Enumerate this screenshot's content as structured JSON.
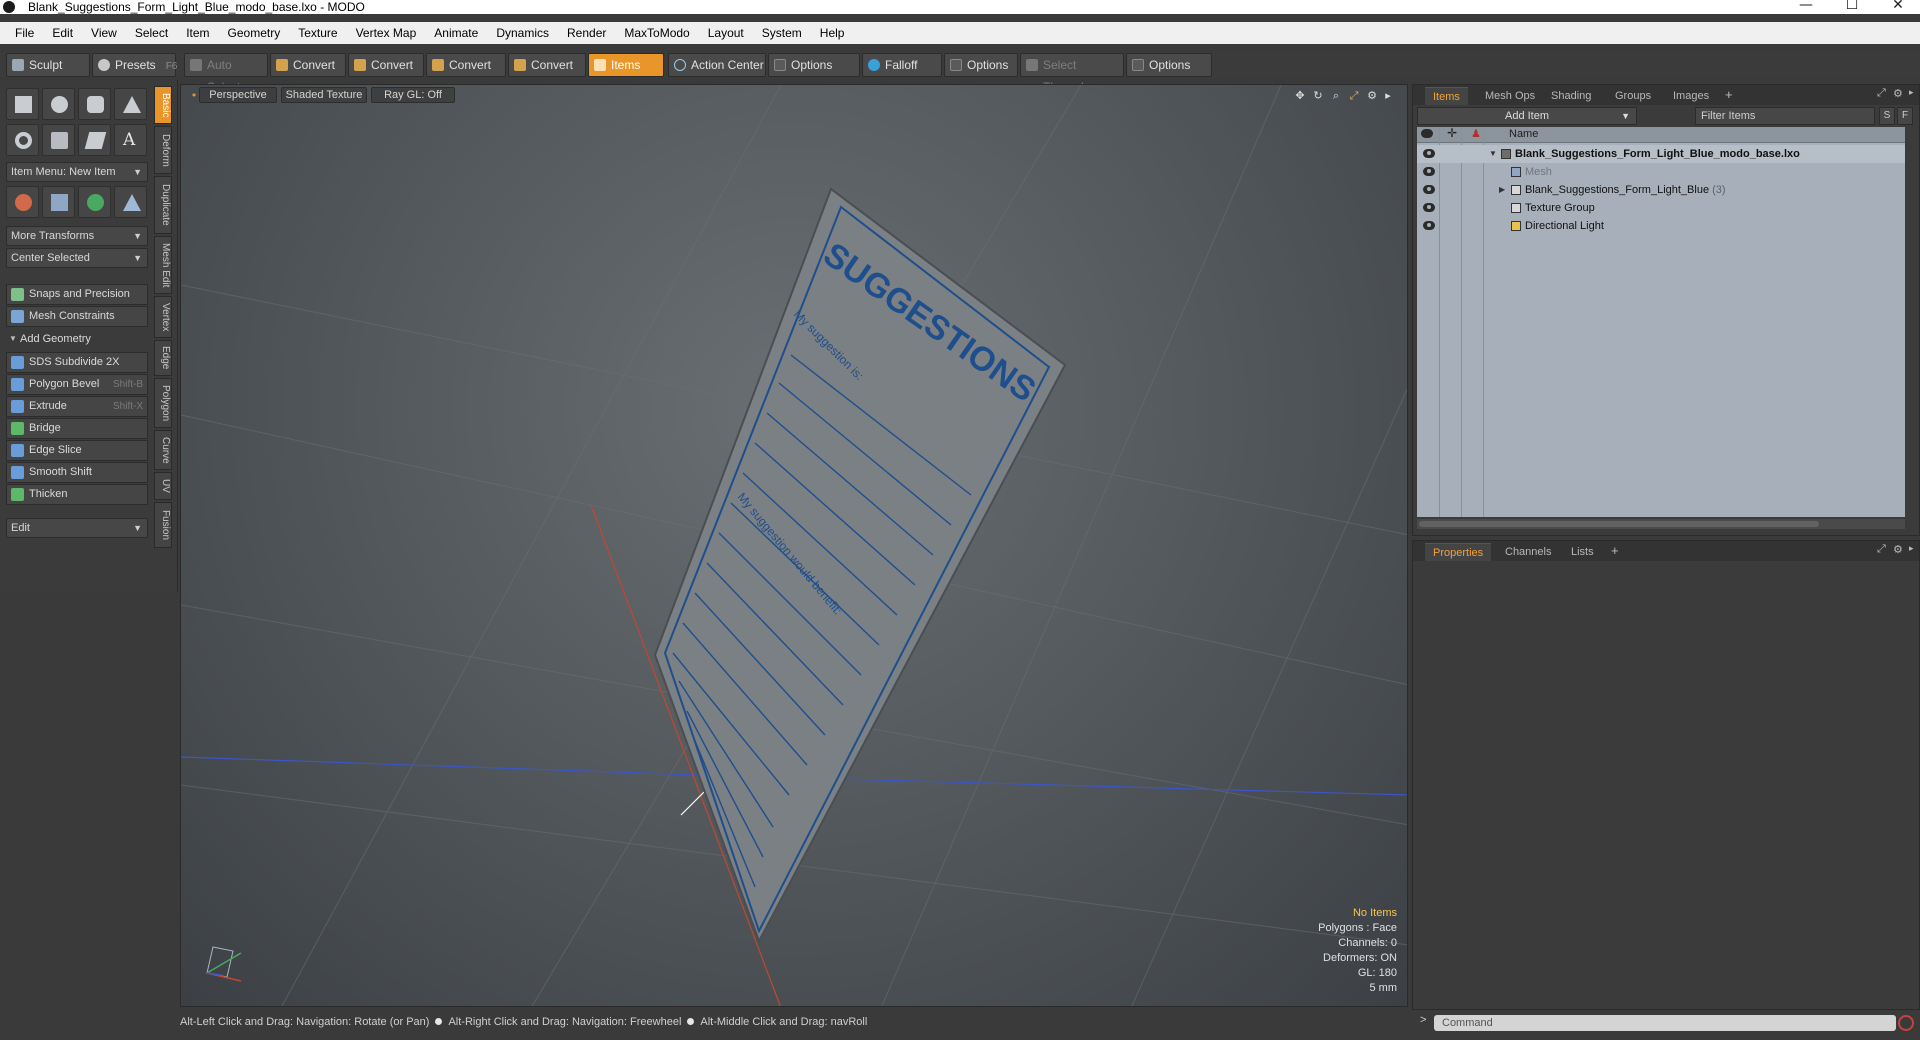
{
  "window": {
    "title": "Blank_Suggestions_Form_Light_Blue_modo_base.lxo - MODO",
    "minimize": "—",
    "maximize": "☐",
    "close": "✕"
  },
  "menu": [
    "File",
    "Edit",
    "View",
    "Select",
    "Item",
    "Geometry",
    "Texture",
    "Vertex Map",
    "Animate",
    "Dynamics",
    "Render",
    "MaxToModo",
    "Layout",
    "System",
    "Help"
  ],
  "toolbar": {
    "sculpt": "Sculpt",
    "presets": "Presets",
    "presets_key": "F6",
    "auto_select": "Auto Select",
    "convert1": "Convert",
    "convert2": "Convert",
    "convert3": "Convert",
    "convert4": "Convert",
    "items": "Items",
    "action_center": "Action Center",
    "options1": "Options",
    "falloff": "Falloff",
    "options2": "Options",
    "select_through": "Select Through",
    "options3": "Options"
  },
  "leftpanel": {
    "item_menu": "Item Menu: New Item",
    "more_transforms": "More Transforms",
    "center_selected": "Center Selected",
    "snaps": "Snaps and Precision",
    "mesh_constraints": "Mesh Constraints",
    "add_geometry": "Add Geometry",
    "tools": [
      {
        "label": "SDS Subdivide 2X",
        "shortcut": ""
      },
      {
        "label": "Polygon Bevel",
        "shortcut": "Shift-B"
      },
      {
        "label": "Extrude",
        "shortcut": "Shift-X"
      },
      {
        "label": "Bridge",
        "shortcut": ""
      },
      {
        "label": "Edge Slice",
        "shortcut": ""
      },
      {
        "label": "Smooth Shift",
        "shortcut": ""
      },
      {
        "label": "Thicken",
        "shortcut": ""
      }
    ],
    "edit": "Edit",
    "vtabs": [
      "Basic",
      "Deform",
      "Duplicate",
      "Mesh Edit",
      "Vertex",
      "Edge",
      "Polygon",
      "Curve",
      "UV",
      "Fusion"
    ]
  },
  "viewport": {
    "perspective": "Perspective",
    "shading": "Shaded Texture",
    "raygl": "Ray GL: Off",
    "form_title": "SUGGESTIONS",
    "form_line1": "My suggestion is:",
    "form_line2": "My suggestion would benefit:",
    "stats": {
      "items": "No Items",
      "polygons": "Polygons : Face",
      "channels": "Channels: 0",
      "deformers": "Deformers: ON",
      "gl": "GL: 180",
      "scale": "5 mm"
    }
  },
  "status": {
    "hint1": "Alt-Left Click and Drag: Navigation: Rotate (or Pan)",
    "hint2": "Alt-Right Click and Drag: Navigation: Freewheel",
    "hint3": "Alt-Middle Click and Drag: navRoll"
  },
  "items_panel": {
    "tabs": [
      "Items",
      "Mesh Ops",
      "Shading",
      "Groups",
      "Images"
    ],
    "add_item": "Add Item",
    "filter": "Filter Items",
    "s_btn": "S",
    "f_btn": "F",
    "col_name": "Name",
    "tree": [
      {
        "label": "Blank_Suggestions_Form_Light_Blue_modo_base.lxo",
        "count": ""
      },
      {
        "label": "Mesh",
        "count": ""
      },
      {
        "label": "Blank_Suggestions_Form_Light_Blue",
        "count": "(3)"
      },
      {
        "label": "Texture Group",
        "count": ""
      },
      {
        "label": "Directional Light",
        "count": ""
      }
    ]
  },
  "properties_panel": {
    "tabs": [
      "Properties",
      "Channels",
      "Lists"
    ]
  },
  "command": {
    "prompt": ">",
    "placeholder": "Command"
  },
  "colors": {
    "accent": "#e8962a",
    "form_blue": "#1f4e8c"
  }
}
